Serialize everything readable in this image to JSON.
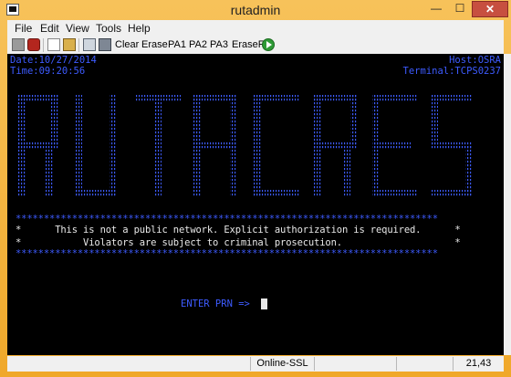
{
  "window": {
    "title": "rutadmin",
    "controls": {
      "minimize": "—",
      "maximize": "☐",
      "close": "✕"
    }
  },
  "menu": [
    "File",
    "Edit",
    "View",
    "Tools",
    "Help"
  ],
  "toolbar": {
    "icons": [
      "disconnect-icon",
      "reconnect-icon",
      "copy-icon",
      "paste-icon",
      "print-icon",
      "macro-icon"
    ],
    "buttons": [
      "Clear",
      "Erase",
      "PA1",
      "PA2",
      "PA3",
      "EraseF"
    ],
    "run_icon": "play-icon"
  },
  "terminal": {
    "date": "Date:10/27/2014",
    "time": "Time:09:20:56",
    "host": "Host:OSRA",
    "terminal_id": "Terminal:TCPS0237",
    "banner_rule": "***************************************************************************",
    "banner_line1": "*      This is not a public network. Explicit authorization is required.      *",
    "banner_line2": "*           Violators are subject to criminal prosecution.                    *",
    "prompt": "ENTER PRN =>",
    "colors": {
      "field": "#3d5bff",
      "text": "#e8e8e8",
      "background": "#000000"
    }
  },
  "status": {
    "connection": "Online-SSL",
    "cursor_pos": "21,43"
  }
}
